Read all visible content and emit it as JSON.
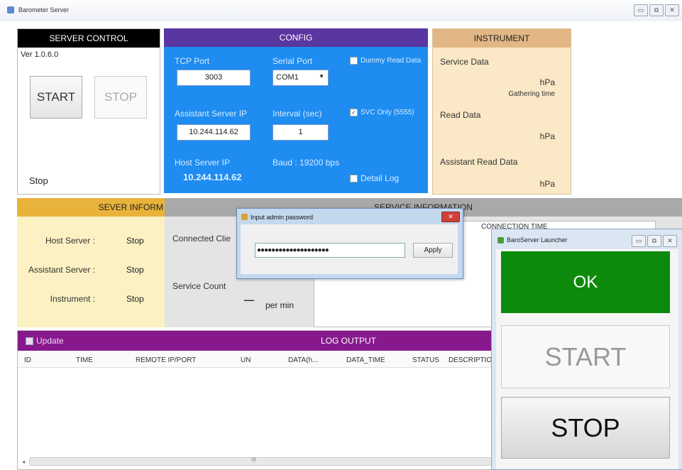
{
  "window": {
    "title": "Barometer Server"
  },
  "server_control": {
    "header": "SERVER CONTROL",
    "version": "Ver 1.0.6.0",
    "start": "START",
    "stop": "STOP",
    "status": "Stop"
  },
  "config": {
    "header": "CONFIG",
    "tcp_port_label": "TCP Port",
    "tcp_port_value": "3003",
    "serial_port_label": "Serial Port",
    "serial_port_value": "COM1",
    "dummy_read_label": "Dummy Read Data",
    "assistant_ip_label": "Assistant Server IP",
    "assistant_ip_value": "10.244.114.62",
    "interval_label": "Interval (sec)",
    "interval_value": "1",
    "svc_only_label": "SVC Only (5555)",
    "host_ip_label": "Host Server IP",
    "host_ip_value": "10.244.114.62",
    "baud_label": "Baud : 19200 bps",
    "detail_log_label": "Detail Log"
  },
  "instrument": {
    "header": "INSTRUMENT",
    "service_data": "Service Data",
    "service_unit": "hPa",
    "gathering": "Gathering time",
    "read_data": "Read Data",
    "read_unit": "hPa",
    "assistant_read": "Assistant Read Data",
    "assistant_unit": "hPa"
  },
  "server_info": {
    "header": "SEVER INFORM",
    "host_label": "Host Server :",
    "host_value": "Stop",
    "assistant_label": "Assistant Server :",
    "assistant_value": "Stop",
    "instrument_label": "Instrument :",
    "instrument_value": "Stop"
  },
  "service_info": {
    "header": "SERVICE INFORMATION",
    "connected_label": "Connected Clie",
    "service_count_label": "Service Count",
    "dash": "—",
    "per_min": "per min",
    "connection_time_col": "CONNECTION TIME"
  },
  "password_dialog": {
    "title": "Input admin password",
    "value": "●●●●●●●●●●●●●●●●●●●●",
    "apply": "Apply"
  },
  "log": {
    "update_label": "Update",
    "header": "LOG OUTPUT",
    "columns": [
      "ID",
      "TIME",
      "REMOTE IP/PORT",
      "UN",
      "DATA(h...",
      "DATA_TIME",
      "STATUS",
      "DESCRIPTIO"
    ],
    "scroll_mid": "III"
  },
  "launcher": {
    "title": "BaroServer Launcher",
    "ok": "OK",
    "start": "START",
    "stop": "STOP"
  }
}
